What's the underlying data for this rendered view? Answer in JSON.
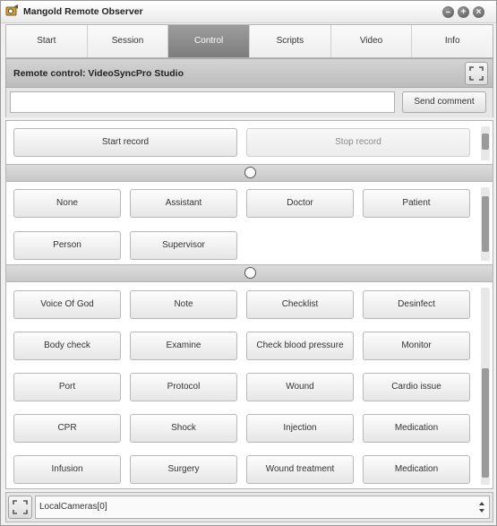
{
  "window": {
    "title": "Mangold Remote Observer",
    "icons": {
      "app": "app-logo-icon",
      "buttons": [
        "minimize-icon",
        "maximize-icon",
        "close-icon"
      ]
    },
    "controls": {
      "minimize": "–",
      "maximize": "+",
      "close": "×"
    }
  },
  "tabs": [
    {
      "label": "Start",
      "active": false
    },
    {
      "label": "Session",
      "active": false
    },
    {
      "label": "Control",
      "active": true
    },
    {
      "label": "Scripts",
      "active": false
    },
    {
      "label": "Video",
      "active": false
    },
    {
      "label": "Info",
      "active": false
    }
  ],
  "header": {
    "title": "Remote control: VideoSyncPro Studio"
  },
  "comment": {
    "value": "",
    "placeholder": "",
    "send_label": "Send comment"
  },
  "record": {
    "start_label": "Start record",
    "stop_label": "Stop record"
  },
  "roles": [
    "None",
    "Assistant",
    "Doctor",
    "Patient",
    "Person",
    "Supervisor"
  ],
  "events": [
    "Voice Of God",
    "Note",
    "Checklist",
    "Desinfect",
    "Body check",
    "Examine",
    "Check blood pressure",
    "Monitor",
    "Port",
    "Protocol",
    "Wound",
    "Cardio issue",
    "CPR",
    "Shock",
    "Injection",
    "Medication",
    "Infusion",
    "Surgery",
    "Wound treatment",
    "Medication"
  ],
  "camera": {
    "selected": "LocalCameras[0]"
  },
  "colors": {
    "active_tab": "#8a8a8a",
    "header": "#c8c8c8"
  }
}
